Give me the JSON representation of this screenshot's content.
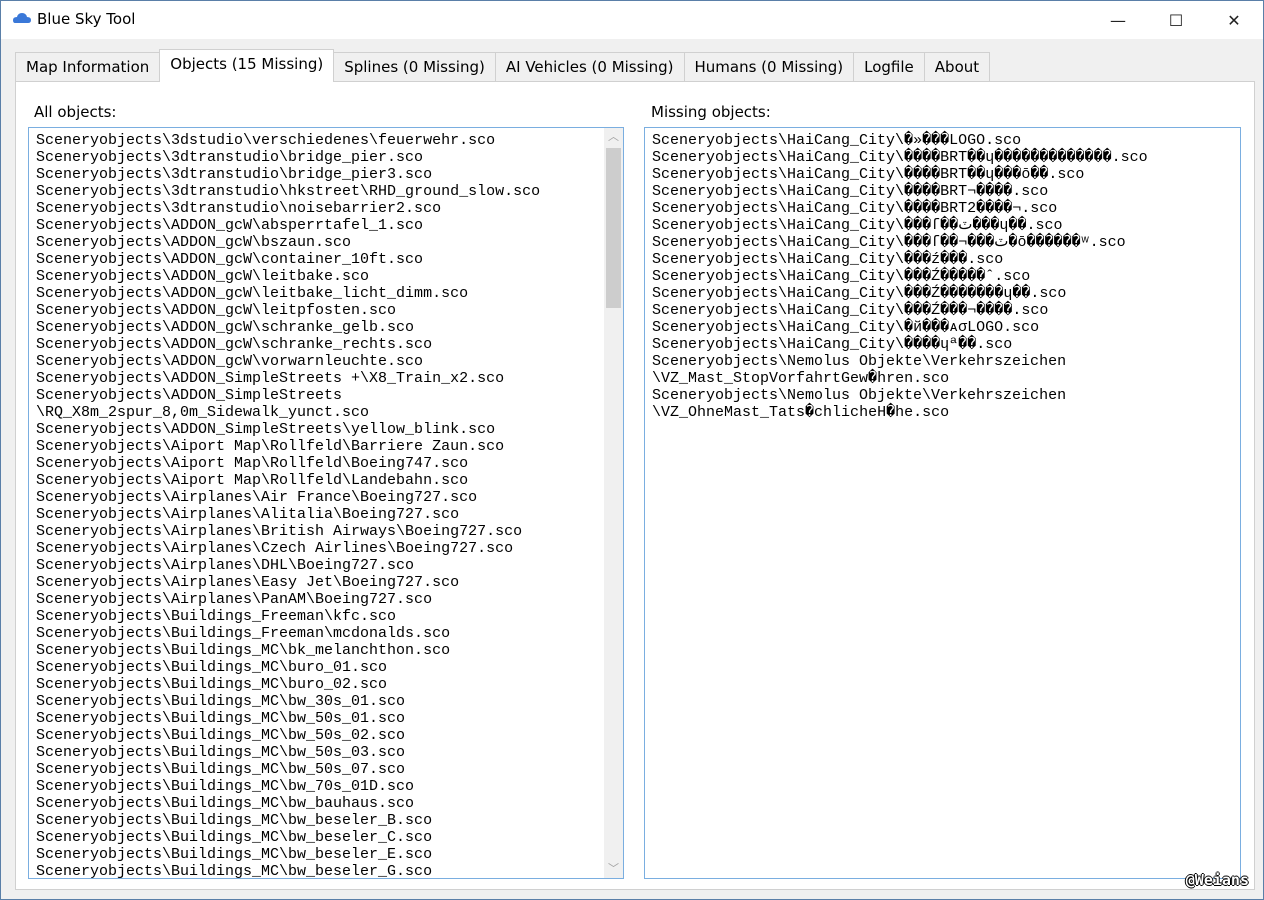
{
  "window": {
    "title": "Blue Sky Tool",
    "minimize": "—",
    "maximize": "☐",
    "close": "✕"
  },
  "tabs": [
    "Map Information",
    "Objects (15 Missing)",
    "Splines (0 Missing)",
    "AI Vehicles (0 Missing)",
    "Humans (0 Missing)",
    "Logfile",
    "About"
  ],
  "active_tab": 1,
  "all_objects": {
    "label": "All objects:",
    "items": [
      "Sceneryobjects\\3dstudio\\verschiedenes\\feuerwehr.sco",
      "Sceneryobjects\\3dtranstudio\\bridge_pier.sco",
      "Sceneryobjects\\3dtranstudio\\bridge_pier3.sco",
      "Sceneryobjects\\3dtranstudio\\hkstreet\\RHD_ground_slow.sco",
      "Sceneryobjects\\3dtranstudio\\noisebarrier2.sco",
      "Sceneryobjects\\ADDON_gcW\\absperrtafel_1.sco",
      "Sceneryobjects\\ADDON_gcW\\bszaun.sco",
      "Sceneryobjects\\ADDON_gcW\\container_10ft.sco",
      "Sceneryobjects\\ADDON_gcW\\leitbake.sco",
      "Sceneryobjects\\ADDON_gcW\\leitbake_licht_dimm.sco",
      "Sceneryobjects\\ADDON_gcW\\leitpfosten.sco",
      "Sceneryobjects\\ADDON_gcW\\schranke_gelb.sco",
      "Sceneryobjects\\ADDON_gcW\\schranke_rechts.sco",
      "Sceneryobjects\\ADDON_gcW\\vorwarnleuchte.sco",
      "Sceneryobjects\\ADDON_SimpleStreets +\\X8_Train_x2.sco",
      "Sceneryobjects\\ADDON_SimpleStreets\\RQ_X8m_2spur_8,0m_Sidewalk_yunct.sco",
      "Sceneryobjects\\ADDON_SimpleStreets\\yellow_blink.sco",
      "Sceneryobjects\\Aiport Map\\Rollfeld\\Barriere Zaun.sco",
      "Sceneryobjects\\Aiport Map\\Rollfeld\\Boeing747.sco",
      "Sceneryobjects\\Aiport Map\\Rollfeld\\Landebahn.sco",
      "Sceneryobjects\\Airplanes\\Air France\\Boeing727.sco",
      "Sceneryobjects\\Airplanes\\Alitalia\\Boeing727.sco",
      "Sceneryobjects\\Airplanes\\British Airways\\Boeing727.sco",
      "Sceneryobjects\\Airplanes\\Czech Airlines\\Boeing727.sco",
      "Sceneryobjects\\Airplanes\\DHL\\Boeing727.sco",
      "Sceneryobjects\\Airplanes\\Easy Jet\\Boeing727.sco",
      "Sceneryobjects\\Airplanes\\PanAM\\Boeing727.sco",
      "Sceneryobjects\\Buildings_Freeman\\kfc.sco",
      "Sceneryobjects\\Buildings_Freeman\\mcdonalds.sco",
      "Sceneryobjects\\Buildings_MC\\bk_melanchthon.sco",
      "Sceneryobjects\\Buildings_MC\\buro_01.sco",
      "Sceneryobjects\\Buildings_MC\\buro_02.sco",
      "Sceneryobjects\\Buildings_MC\\bw_30s_01.sco",
      "Sceneryobjects\\Buildings_MC\\bw_50s_01.sco",
      "Sceneryobjects\\Buildings_MC\\bw_50s_02.sco",
      "Sceneryobjects\\Buildings_MC\\bw_50s_03.sco",
      "Sceneryobjects\\Buildings_MC\\bw_50s_07.sco",
      "Sceneryobjects\\Buildings_MC\\bw_70s_01D.sco",
      "Sceneryobjects\\Buildings_MC\\bw_bauhaus.sco",
      "Sceneryobjects\\Buildings_MC\\bw_beseler_B.sco",
      "Sceneryobjects\\Buildings_MC\\bw_beseler_C.sco",
      "Sceneryobjects\\Buildings_MC\\bw_beseler_E.sco",
      "Sceneryobjects\\Buildings_MC\\bw_beseler_G.sco"
    ]
  },
  "missing_objects": {
    "label": "Missing objects:",
    "items": [
      "Sceneryobjects\\HaiCang_City\\�»���LOGO.sco",
      "Sceneryobjects\\HaiCang_City\\����BRT��ɥ����̉���������.sco",
      "Sceneryobjects\\HaiCang_City\\����BRT��ɥ���ō��.sco",
      "Sceneryobjects\\HaiCang_City\\����BRT¬����.sco",
      "Sceneryobjects\\HaiCang_City\\����BRT2����¬.sco",
      "Sceneryobjects\\HaiCang_City\\���ſ��ٽ���ɥ��.sco",
      "Sceneryobjects\\HaiCang_City\\���ſ��¬���ٽ�ō������ʷ.sco",
      "Sceneryobjects\\HaiCang_City\\���ź���.sco",
      "Sceneryobjects\\HaiCang_City\\���Ź�����ˆ.sco",
      "Sceneryobjects\\HaiCang_City\\���Ź�������ɥ��.sco",
      "Sceneryobjects\\HaiCang_City\\���Ź���¬����.sco",
      "Sceneryobjects\\HaiCang_City\\�й���ᴀσLOGO.sco",
      "Sceneryobjects\\HaiCang_City\\����ɥª��.sco",
      "Sceneryobjects\\Nemolus Objekte\\Verkehrszeichen\\VZ_Mast_StopVorfahrtGew�hren.sco",
      "Sceneryobjects\\Nemolus Objekte\\Verkehrszeichen\\VZ_OhneMast_Tats�chlicheH�he.sco"
    ]
  },
  "watermark": "@Weians"
}
